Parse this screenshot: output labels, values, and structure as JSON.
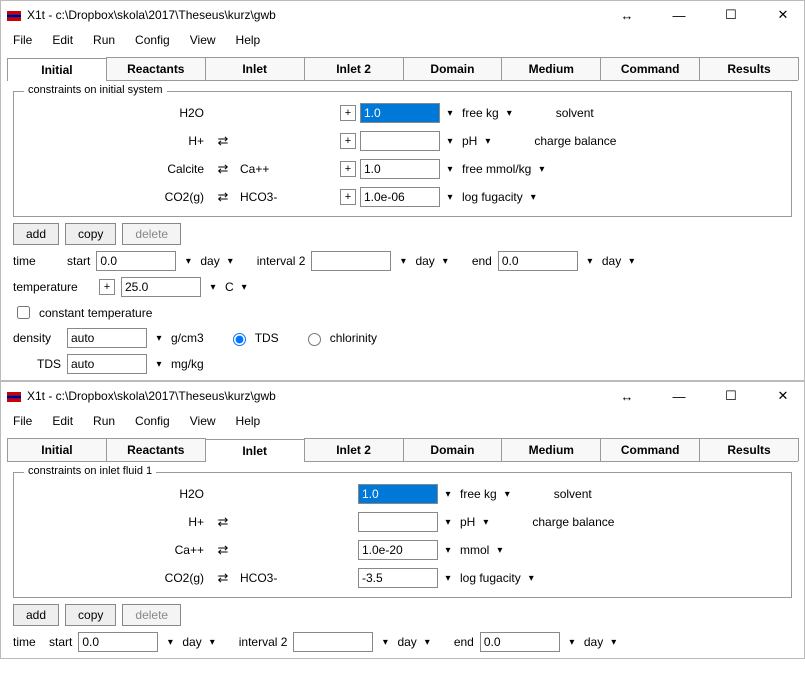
{
  "w1": {
    "title": "X1t - c:\\Dropbox\\skola\\2017\\Theseus\\kurz\\gwb",
    "menu": [
      "File",
      "Edit",
      "Run",
      "Config",
      "View",
      "Help"
    ],
    "tabs": [
      "Initial",
      "Reactants",
      "Inlet",
      "Inlet 2",
      "Domain",
      "Medium",
      "Command",
      "Results"
    ],
    "activeTab": "Initial",
    "legend": "constraints on initial system",
    "constraints": [
      {
        "name": "H2O",
        "swap": "",
        "conv": "",
        "plus": true,
        "val": "1.0",
        "valSel": true,
        "unit": "free kg",
        "note": "solvent"
      },
      {
        "name": "H+",
        "swap": "⇄",
        "conv": "",
        "plus": true,
        "val": "",
        "valSel": false,
        "unit": "pH",
        "note": "charge balance"
      },
      {
        "name": "Calcite",
        "swap": "⇄",
        "conv": "Ca++",
        "plus": true,
        "val": "1.0",
        "valSel": false,
        "unit": "free mmol/kg",
        "note": ""
      },
      {
        "name": "CO2(g)",
        "swap": "⇄",
        "conv": "HCO3-",
        "plus": true,
        "val": "1.0e-06",
        "valSel": false,
        "unit": "log fugacity",
        "note": ""
      }
    ],
    "buttons": {
      "add": "add",
      "copy": "copy",
      "delete": "delete"
    },
    "time": {
      "label": "time",
      "start": "start",
      "startVal": "0.0",
      "startUnit": "day",
      "interval": "interval 2",
      "intervalVal": "",
      "intervalUnit": "day",
      "end": "end",
      "endVal": "0.0",
      "endUnit": "day"
    },
    "temp": {
      "label": "temperature",
      "val": "25.0",
      "unit": "C"
    },
    "constTemp": "constant temperature",
    "density": {
      "label": "density",
      "val": "auto",
      "unit": "g/cm3",
      "tds": "TDS",
      "chl": "chlorinity"
    },
    "tds": {
      "label": "TDS",
      "val": "auto",
      "unit": "mg/kg"
    }
  },
  "w2": {
    "title": "X1t - c:\\Dropbox\\skola\\2017\\Theseus\\kurz\\gwb",
    "menu": [
      "File",
      "Edit",
      "Run",
      "Config",
      "View",
      "Help"
    ],
    "tabs": [
      "Initial",
      "Reactants",
      "Inlet",
      "Inlet 2",
      "Domain",
      "Medium",
      "Command",
      "Results"
    ],
    "activeTab": "Inlet",
    "legend": "constraints on inlet fluid 1",
    "constraints": [
      {
        "name": "H2O",
        "swap": "",
        "conv": "",
        "plus": false,
        "val": "1.0",
        "valSel": true,
        "unit": "free kg",
        "note": "solvent"
      },
      {
        "name": "H+",
        "swap": "⇄",
        "conv": "",
        "plus": false,
        "val": "",
        "valSel": false,
        "unit": "pH",
        "note": "charge balance"
      },
      {
        "name": "Ca++",
        "swap": "⇄",
        "conv": "",
        "plus": false,
        "val": "1.0e-20",
        "valSel": false,
        "unit": "mmol",
        "note": ""
      },
      {
        "name": "CO2(g)",
        "swap": "⇄",
        "conv": "HCO3-",
        "plus": false,
        "val": "-3.5",
        "valSel": false,
        "unit": "log fugacity",
        "note": ""
      }
    ],
    "buttons": {
      "add": "add",
      "copy": "copy",
      "delete": "delete"
    },
    "time": {
      "label": "time",
      "start": "start",
      "startVal": "0.0",
      "startUnit": "day",
      "interval": "interval 2",
      "intervalVal": "",
      "intervalUnit": "day",
      "end": "end",
      "endVal": "0.0",
      "endUnit": "day"
    }
  }
}
